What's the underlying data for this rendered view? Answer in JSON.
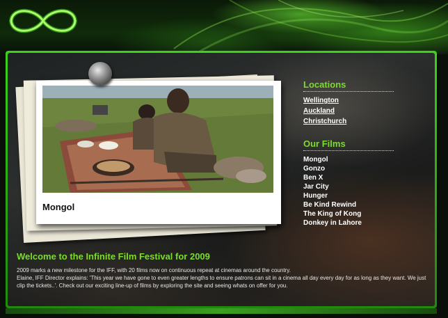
{
  "logo": {
    "icon": "infinity-icon",
    "color": "#5cff2a"
  },
  "sidebar": {
    "locations_title": "Locations",
    "locations": [
      {
        "label": "Wellington"
      },
      {
        "label": "Auckland"
      },
      {
        "label": "Christchurch"
      }
    ],
    "films_title": "Our Films",
    "films": [
      {
        "label": "Mongol"
      },
      {
        "label": "Gonzo"
      },
      {
        "label": "Ben X"
      },
      {
        "label": "Jar City"
      },
      {
        "label": "Hunger"
      },
      {
        "label": "Be Kind Rewind"
      },
      {
        "label": "The King of Kong"
      },
      {
        "label": "Donkey in Lahore"
      }
    ]
  },
  "featured": {
    "title": "Mongol"
  },
  "welcome": {
    "heading": "Welcome to the Infinite Film Festival for 2009",
    "paragraph_1": "2009 marks a new milestone for the IFF, with 20 films now on continuous repeat at cinemas around the country.",
    "paragraph_2": "Elaine, IFF Director explains: 'This year we have gone to even greater lengths to ensure patrons can sit in a cinema all day every day for as long as they want. We just clip the tickets..'. Check out our exciting line-up of films by exploring the site and seeing whats on offer for you."
  },
  "colors": {
    "accent": "#7bdc2e",
    "frame": "#2fb214"
  }
}
